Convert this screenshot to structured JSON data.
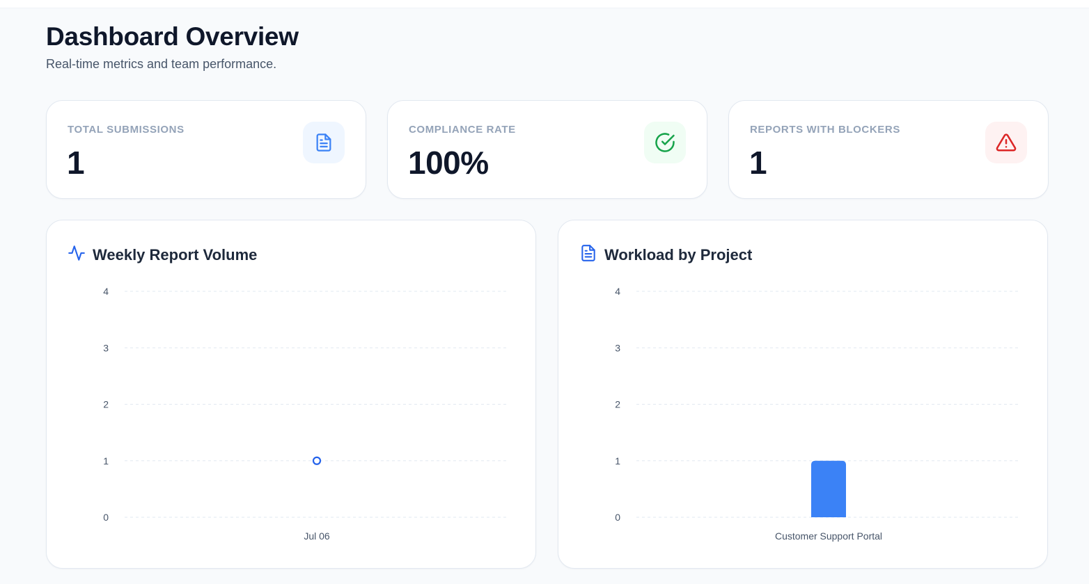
{
  "header": {
    "title": "Dashboard Overview",
    "subtitle": "Real-time metrics and team performance."
  },
  "stats": [
    {
      "label": "Total Submissions",
      "value": "1",
      "icon": "document-icon",
      "color": "#3b82f6"
    },
    {
      "label": "Compliance Rate",
      "value": "100%",
      "icon": "check-circle-icon",
      "color": "#16a34a"
    },
    {
      "label": "Reports with Blockers",
      "value": "1",
      "icon": "warning-triangle-icon",
      "color": "#dc2626"
    }
  ],
  "charts": {
    "weekly": {
      "title": "Weekly Report Volume",
      "icon": "activity-icon"
    },
    "workload": {
      "title": "Workload by Project",
      "icon": "document-icon"
    }
  },
  "chart_data": [
    {
      "type": "line",
      "title": "Weekly Report Volume",
      "categories": [
        "Jul 06"
      ],
      "values": [
        1
      ],
      "yticks": [
        0,
        1,
        2,
        3,
        4
      ],
      "ylim": [
        0,
        4
      ],
      "grid": true,
      "color": "#2563eb"
    },
    {
      "type": "bar",
      "title": "Workload by Project",
      "categories": [
        "Customer Support Portal"
      ],
      "values": [
        1
      ],
      "yticks": [
        0,
        1,
        2,
        3,
        4
      ],
      "ylim": [
        0,
        4
      ],
      "grid": true,
      "color": "#3b82f6"
    }
  ]
}
